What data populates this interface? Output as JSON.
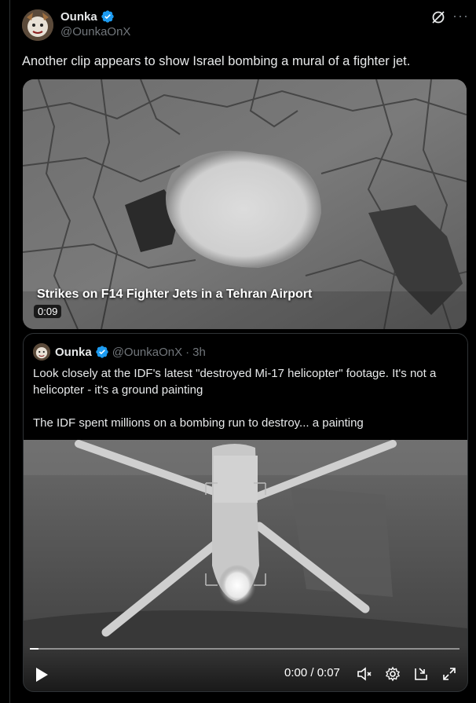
{
  "tweet": {
    "author_name": "Ounka",
    "author_handle": "@OunkaOnX",
    "text": "Another clip appears to show Israel bombing a mural of a fighter jet.",
    "media": {
      "caption": "Strikes on F14 Fighter Jets in a Tehran Airport",
      "duration": "0:09"
    },
    "more_label": "···"
  },
  "quote": {
    "author_name": "Ounka",
    "author_handle": "@OunkaOnX",
    "separator": "·",
    "time_ago": "3h",
    "paragraph1": "Look closely at the IDF's latest \"destroyed Mi-17 helicopter\" footage. It's not a helicopter - it's a ground painting",
    "paragraph2": "The IDF spent millions on a bombing run to destroy... a painting",
    "video": {
      "time_display": "0:00 / 0:07",
      "progress": 0.02
    }
  },
  "colors": {
    "background": "#000000",
    "text_primary": "#e7e9ea",
    "text_secondary": "#71767b",
    "verified_blue": "#1d9bf0",
    "border": "#2f3336"
  },
  "icons": [
    "verified-badge-icon",
    "grok-icon",
    "more-icon",
    "play-icon",
    "mute-icon",
    "settings-icon",
    "pip-icon",
    "fullscreen-icon"
  ]
}
